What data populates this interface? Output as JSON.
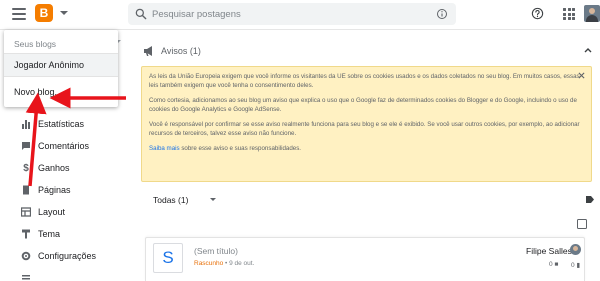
{
  "app": {
    "name": "Blogger"
  },
  "search": {
    "placeholder": "Pesquisar postagens"
  },
  "blog_menu": {
    "header": "Seus blogs",
    "blogs": [
      "Jogador Anônimo"
    ],
    "new_blog": "Novo blog..."
  },
  "sidebar": {
    "items": [
      {
        "label": "Estatísticas",
        "icon": "bar-chart-icon"
      },
      {
        "label": "Comentários",
        "icon": "comment-icon"
      },
      {
        "label": "Ganhos",
        "icon": "dollar-icon"
      },
      {
        "label": "Páginas",
        "icon": "page-icon"
      },
      {
        "label": "Layout",
        "icon": "layout-icon"
      },
      {
        "label": "Tema",
        "icon": "theme-icon"
      },
      {
        "label": "Configurações",
        "icon": "gear-icon"
      }
    ]
  },
  "notices": {
    "title": "Avisos (1)",
    "paragraph1": "As leis da União Europeia exigem que você informe os visitantes da UE sobre os cookies usados e os dados coletados no seu blog. Em muitos casos, essas leis também exigem que você tenha o consentimento deles.",
    "paragraph2": "Como cortesia, adicionamos ao seu blog um aviso que explica o uso que o Google faz de determinados cookies do Blogger e do Google, incluindo o uso de cookies do Google Analytics e Google AdSense.",
    "paragraph3": "Você é responsável por confirmar se esse aviso realmente funciona para seu blog e se ele é exibido. Se você usar outros cookies, por exemplo, ao adicionar recursos de terceiros, talvez esse aviso não funcione.",
    "learn_more_link": "Saiba mais",
    "learn_more_rest": " sobre esse aviso e suas responsabilidades."
  },
  "posts": {
    "filter_label": "Todas (1)",
    "items": [
      {
        "thumb_letter": "S",
        "title": "(Sem título)",
        "status": "Rascunho",
        "date": "• 9 de out.",
        "author": "Filipe Salles",
        "comments": "0",
        "views": "0"
      }
    ]
  },
  "colors": {
    "brand": "#f57d00",
    "notice_bg": "#fff1c2",
    "arrow": "#e8141b",
    "link": "#1a73e8",
    "draft": "#e8710a"
  }
}
